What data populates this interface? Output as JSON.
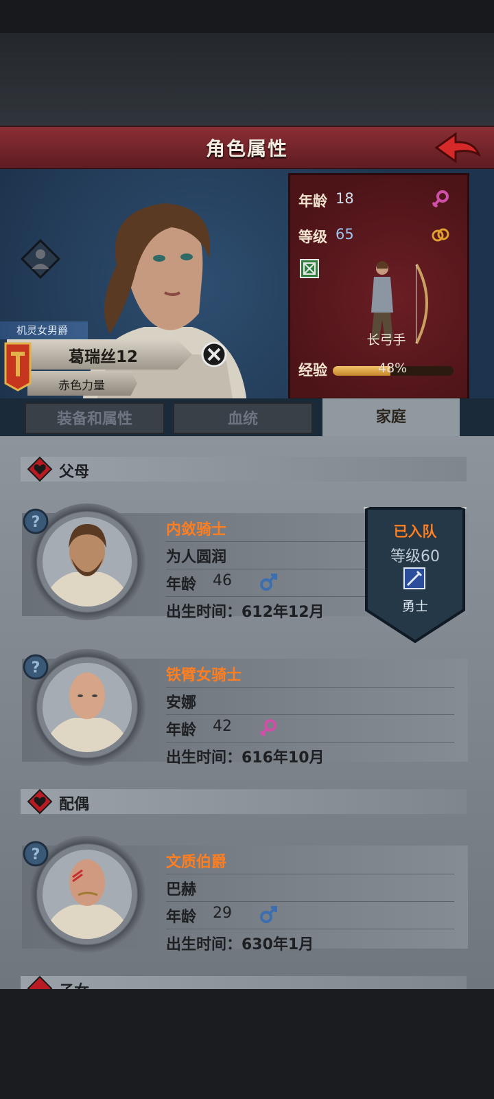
{
  "header": {
    "title": "角色属性"
  },
  "hero": {
    "class_ribbon": "机灵女男爵",
    "name": "葛瑞丝12",
    "subtitle": "赤色力量",
    "stats": {
      "age_label": "年龄",
      "age_value": "18",
      "level_label": "等级",
      "level_value": "65",
      "unit_name": "长弓手",
      "exp_label": "经验",
      "exp_value": "48%",
      "exp_fraction": 0.48
    }
  },
  "tabs": [
    {
      "label": "装备和属性",
      "active": false
    },
    {
      "label": "血统",
      "active": false
    },
    {
      "label": "家庭",
      "active": true
    }
  ],
  "sections": {
    "parents": "父母",
    "spouse": "配偶",
    "children": "子女"
  },
  "members": [
    {
      "title": "内敛骑士",
      "trait": "为人圆润",
      "age_label": "年龄",
      "age": "46",
      "sex": "male",
      "born": "出生时间：612年12月"
    },
    {
      "title": "铁臂女骑士",
      "trait": "安娜",
      "age_label": "年龄",
      "age": "42",
      "sex": "female",
      "born": "出生时间：616年10月"
    },
    {
      "title": "文质伯爵",
      "trait": "巴赫",
      "age_label": "年龄",
      "age": "29",
      "sex": "male",
      "born": "出生时间：630年1月"
    }
  ],
  "team_badge": {
    "status": "已入队",
    "level": "等级60",
    "role": "勇士"
  },
  "colors": {
    "title_bar": "#7a2830",
    "accent_orange": "#ff7e1f",
    "male": "#3d6fb0",
    "female": "#d04fa8"
  }
}
